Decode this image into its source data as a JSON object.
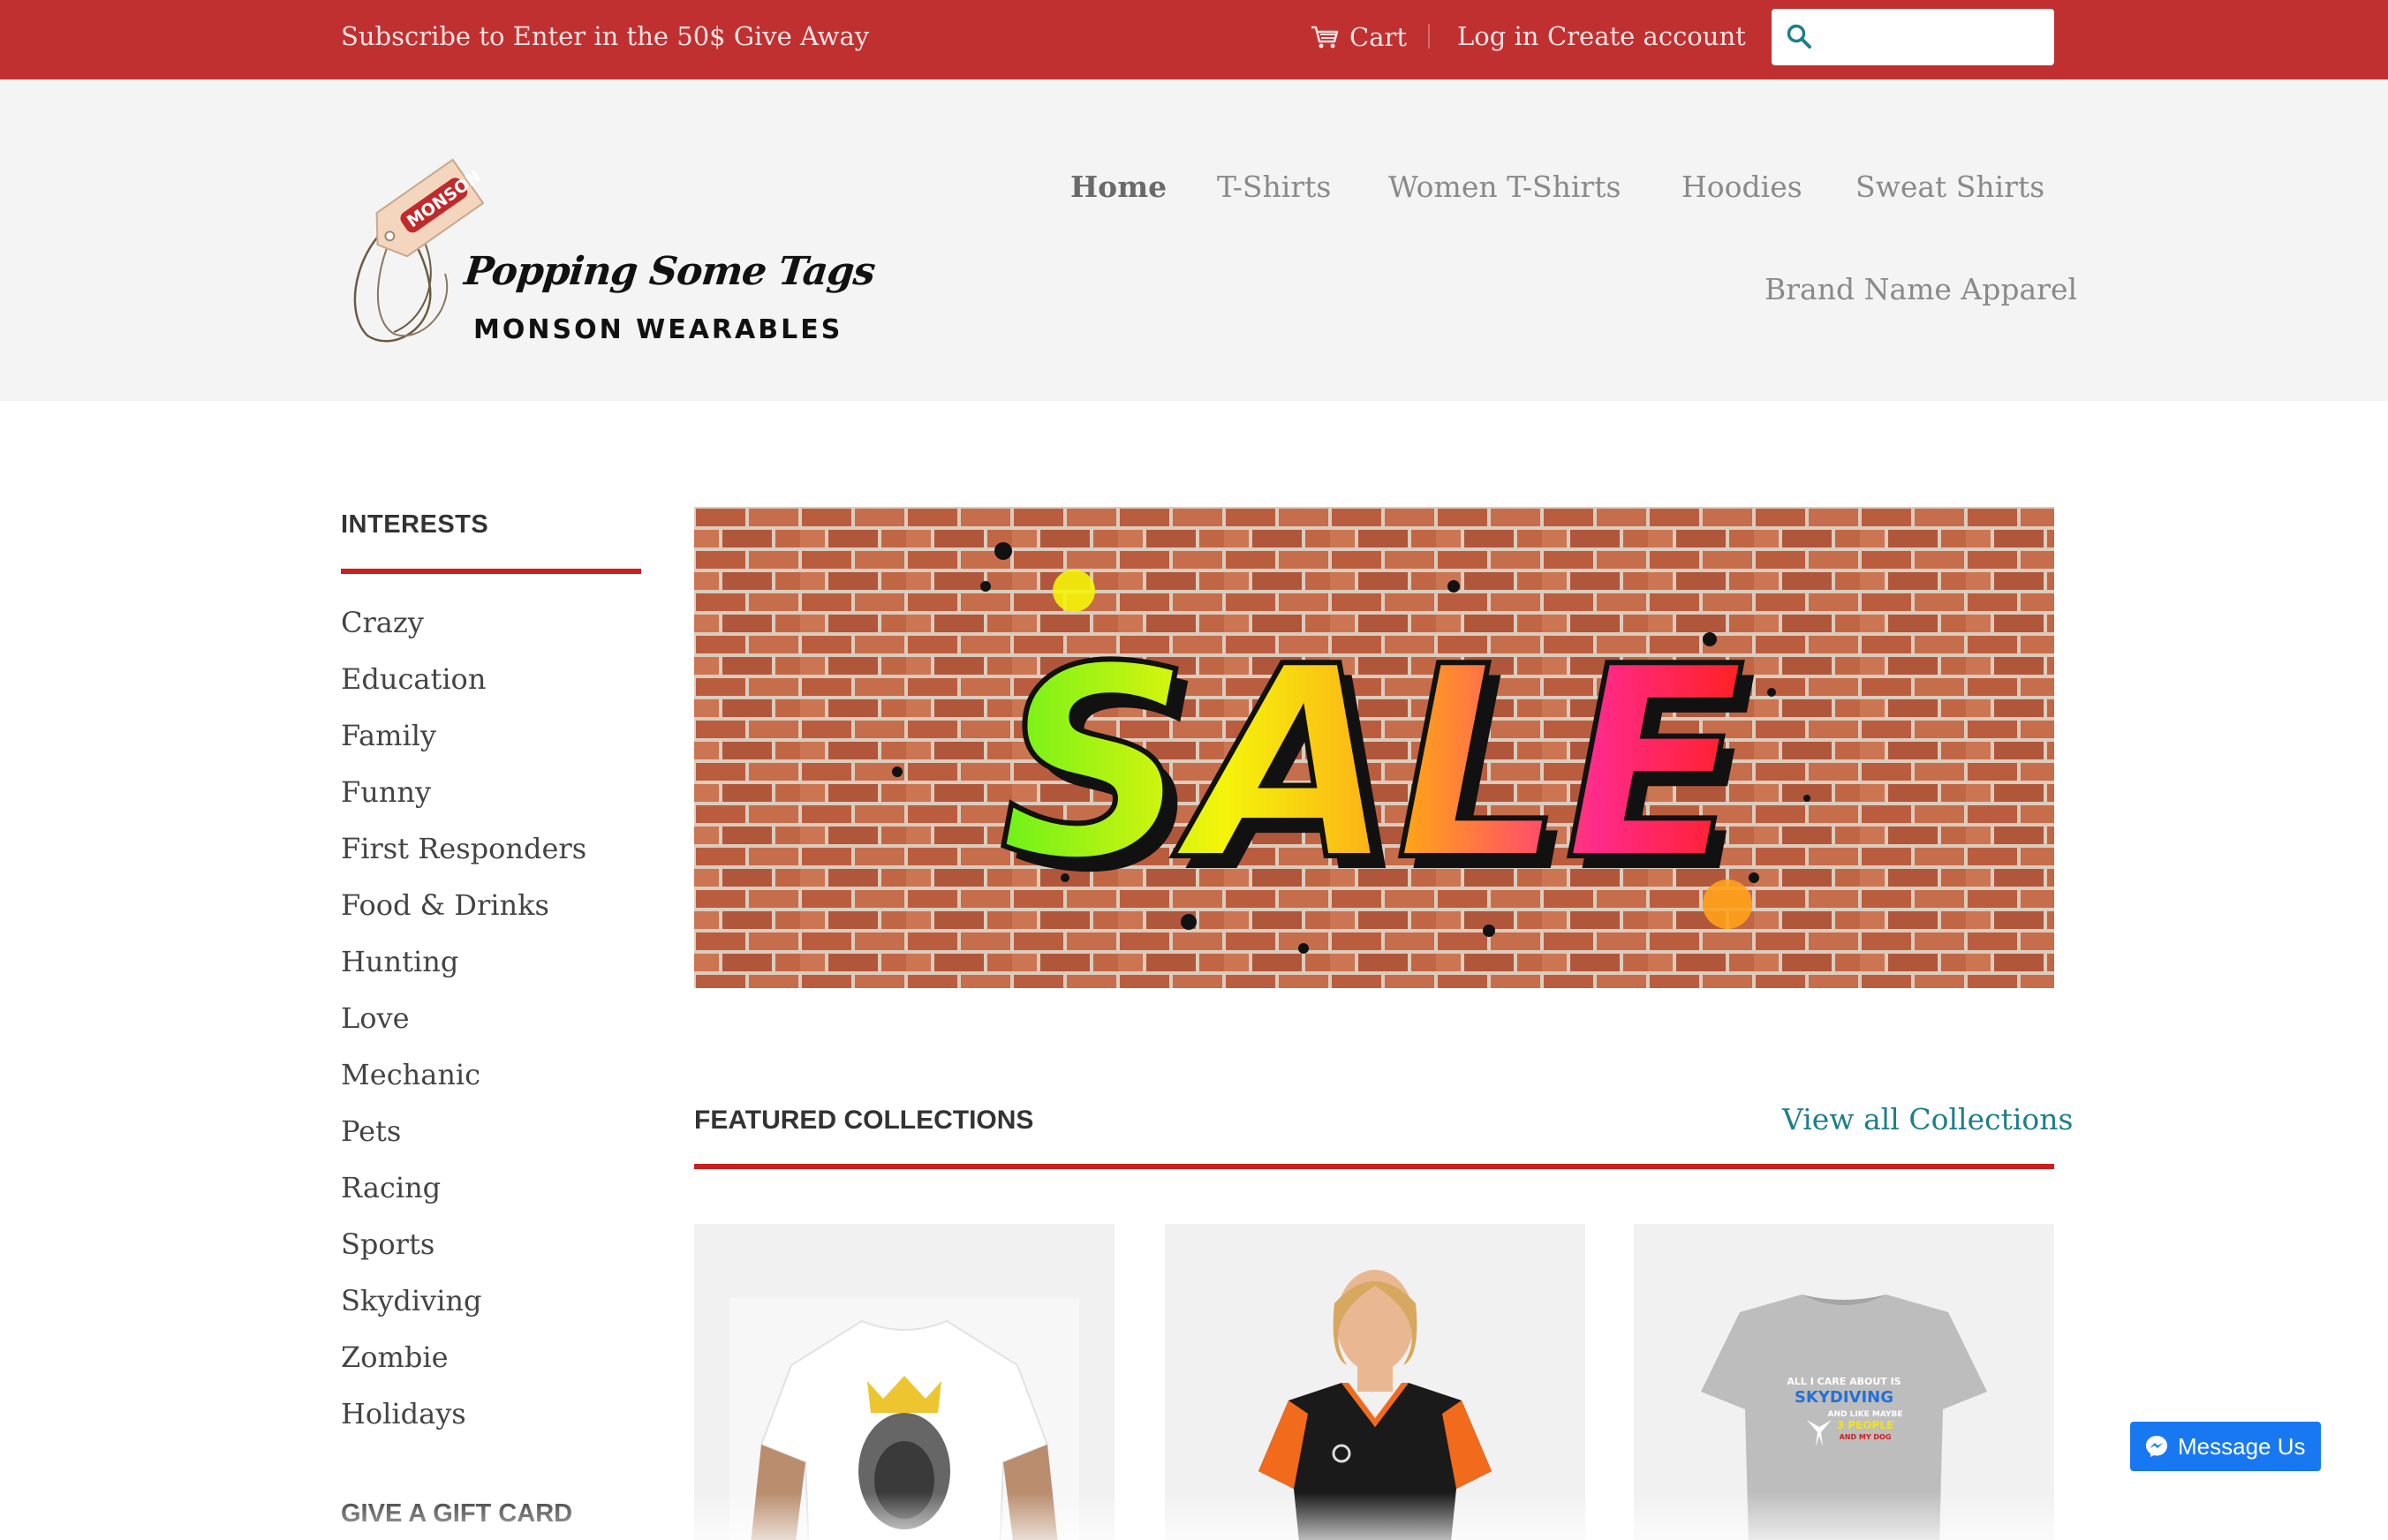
{
  "topbar": {
    "promo": "Subscribe to Enter in the 50$ Give Away",
    "cart_label": "Cart",
    "login_label": "Log in",
    "create_label": "Create account",
    "search_placeholder": ""
  },
  "brand": {
    "tag_text": "MONSON",
    "title": "Popping Some Tags",
    "subtitle": "MONSON WEARABLES"
  },
  "nav": {
    "home": "Home",
    "tshirts": "T-Shirts",
    "women": "Women T-Shirts",
    "hoodies": "Hoodies",
    "sweat": "Sweat Shirts",
    "brand": "Brand Name Apparel"
  },
  "sidebar": {
    "title": "INTERESTS",
    "items": [
      "Crazy",
      "Education",
      "Family",
      "Funny",
      "First Responders",
      "Food & Drinks",
      "Hunting",
      "Love",
      "Mechanic",
      "Pets",
      "Racing",
      "Sports",
      "Skydiving",
      "Zombie",
      "Holidays"
    ],
    "gift_title": "GIVE A GIFT CARD"
  },
  "banner": {
    "text": "SALE"
  },
  "featured": {
    "title": "FEATURED COLLECTIONS",
    "view_all": "View all Collections",
    "shirt3_lines": [
      "ALL I CARE ABOUT IS",
      "SKYDIVING",
      "AND LIKE MAYBE",
      "3 PEOPLE",
      "AND MY DOG"
    ]
  },
  "messenger": {
    "label": "Message Us"
  },
  "colors": {
    "topbar": "#c03030",
    "accent_rule": "#cc1f1f",
    "link": "#1d7e8c",
    "messenger": "#1778f2"
  },
  "icons": [
    "cart-icon",
    "search-icon",
    "messenger-icon"
  ]
}
